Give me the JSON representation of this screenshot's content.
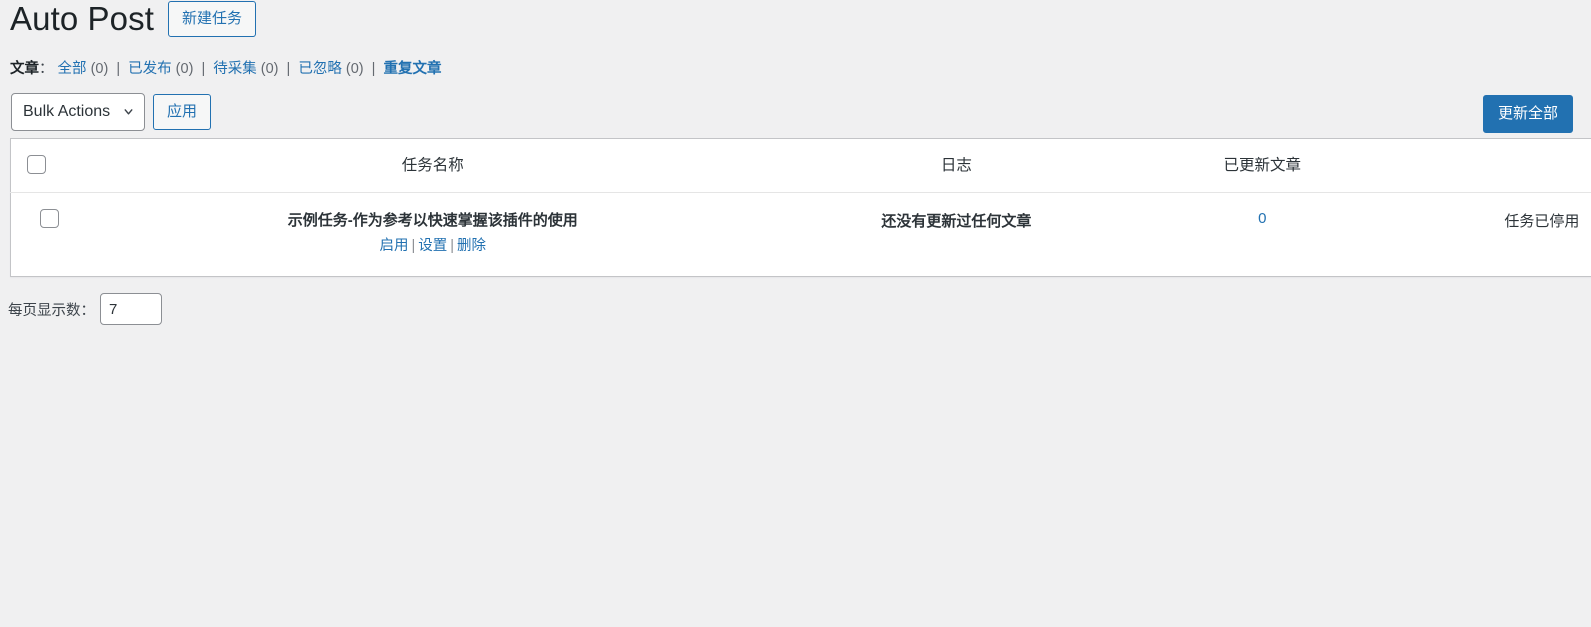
{
  "header": {
    "title": "Auto Post",
    "new_task_label": "新建任务"
  },
  "filters": {
    "label": "文章",
    "colon": "：",
    "items": [
      {
        "label": "全部",
        "count": "(0)",
        "current": false
      },
      {
        "label": "已发布",
        "count": "(0)",
        "current": false
      },
      {
        "label": "待采集",
        "count": "(0)",
        "current": false
      },
      {
        "label": "已忽略",
        "count": "(0)",
        "current": false
      },
      {
        "label": "重复文章",
        "count": "",
        "current": true
      }
    ],
    "separator": "|"
  },
  "toolbar": {
    "bulk_actions_label": "Bulk Actions",
    "bulk_actions_options": [
      "Bulk Actions"
    ],
    "apply_label": "应用",
    "update_all_label": "更新全部"
  },
  "table": {
    "columns": [
      "",
      "任务名称",
      "日志",
      "已更新文章",
      ""
    ],
    "rows": [
      {
        "name": "示例任务-作为参考以快速掌握该插件的使用",
        "actions": [
          "启用",
          "设置",
          "删除"
        ],
        "action_separator": "|",
        "log": "还没有更新过任何文章",
        "updated_count": "0",
        "state": "任务已停用"
      }
    ]
  },
  "footer": {
    "per_page_label": "每页显示数：",
    "per_page_value": "7"
  },
  "colors": {
    "accent": "#2271b1",
    "page_bg": "#f0f0f1",
    "table_bg": "#ffffff",
    "border": "#c3c4c7",
    "text": "#2c3338"
  }
}
